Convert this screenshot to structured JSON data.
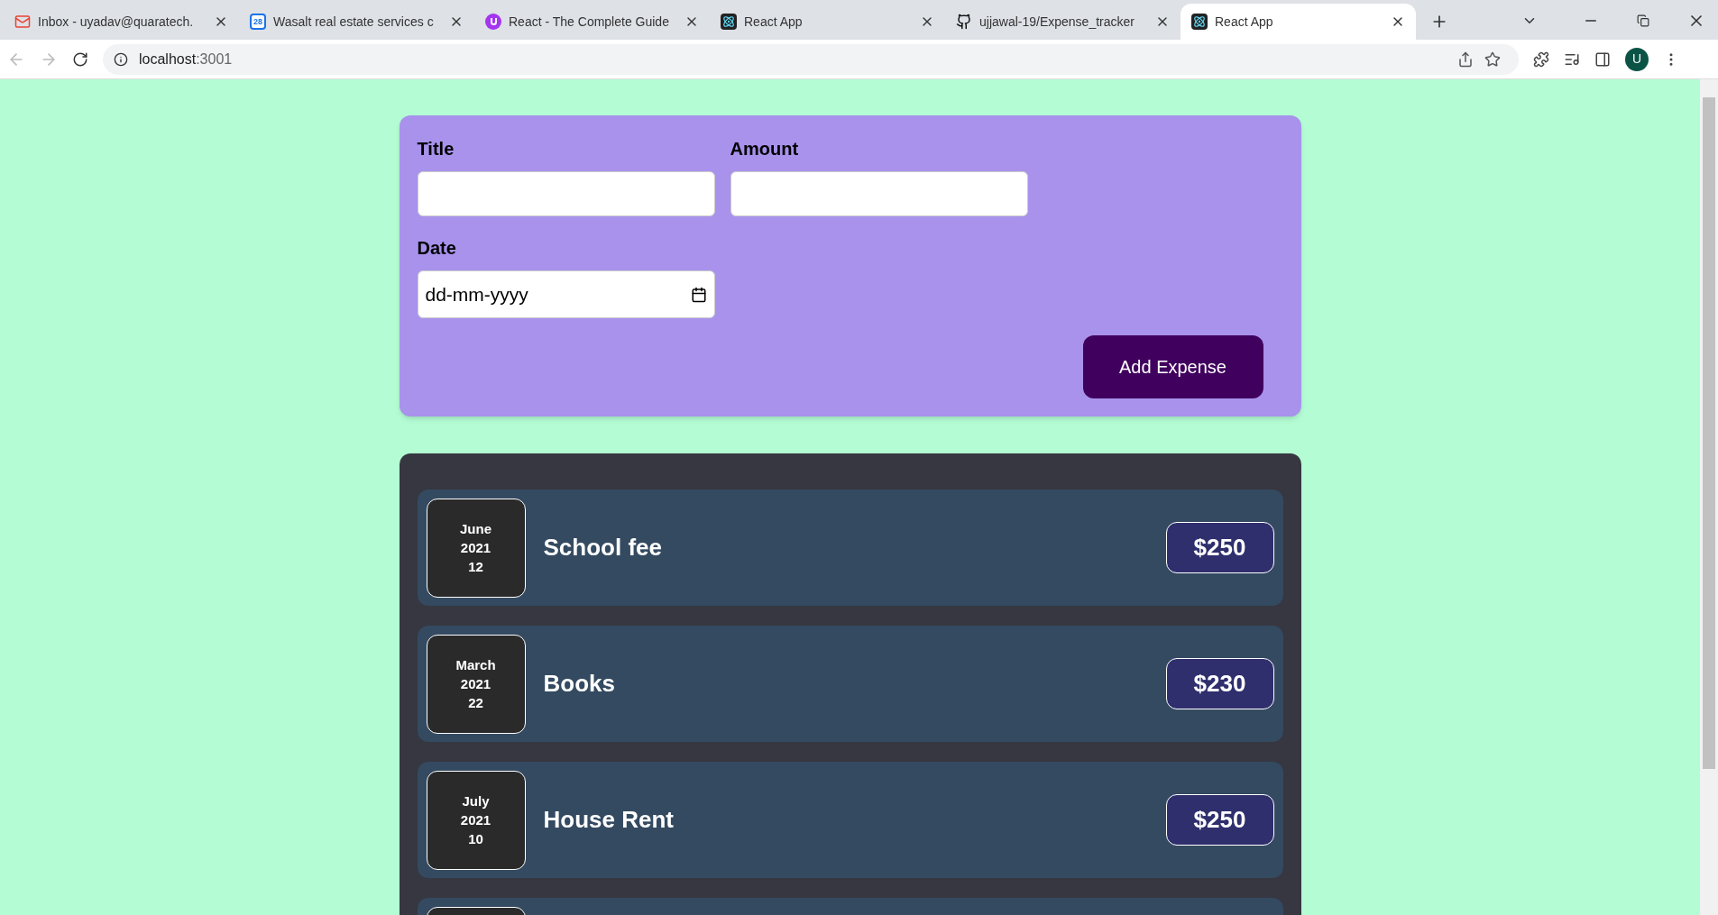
{
  "browser": {
    "tabs": [
      {
        "title": "Inbox - uyadav@quaratech.",
        "kind": "mail",
        "selected": false
      },
      {
        "title": "Wasalt real estate services c",
        "kind": "calendar",
        "selected": false
      },
      {
        "title": "React - The Complete Guide",
        "kind": "course",
        "selected": false
      },
      {
        "title": "React App",
        "kind": "react",
        "selected": false
      },
      {
        "title": "ujjawal-19/Expense_tracker",
        "kind": "github",
        "selected": false
      },
      {
        "title": "React App",
        "kind": "react",
        "selected": true
      }
    ],
    "calendar_day": "28",
    "address": {
      "host": "localhost",
      "port": ":3001"
    },
    "profile_initial": "U"
  },
  "form": {
    "fields": [
      {
        "label": "Title",
        "kind": "text"
      },
      {
        "label": "Amount",
        "kind": "text"
      },
      {
        "label": "Date",
        "kind": "date",
        "placeholder": "dd-mm-yyyy"
      }
    ],
    "submit": "Add Expense"
  },
  "expenses": [
    {
      "month": "June",
      "year": "2021",
      "day": "12",
      "title": "School fee",
      "amount": "$250"
    },
    {
      "month": "March",
      "year": "2021",
      "day": "22",
      "title": "Books",
      "amount": "$230"
    },
    {
      "month": "July",
      "year": "2021",
      "day": "10",
      "title": "House Rent",
      "amount": "$250"
    }
  ]
}
